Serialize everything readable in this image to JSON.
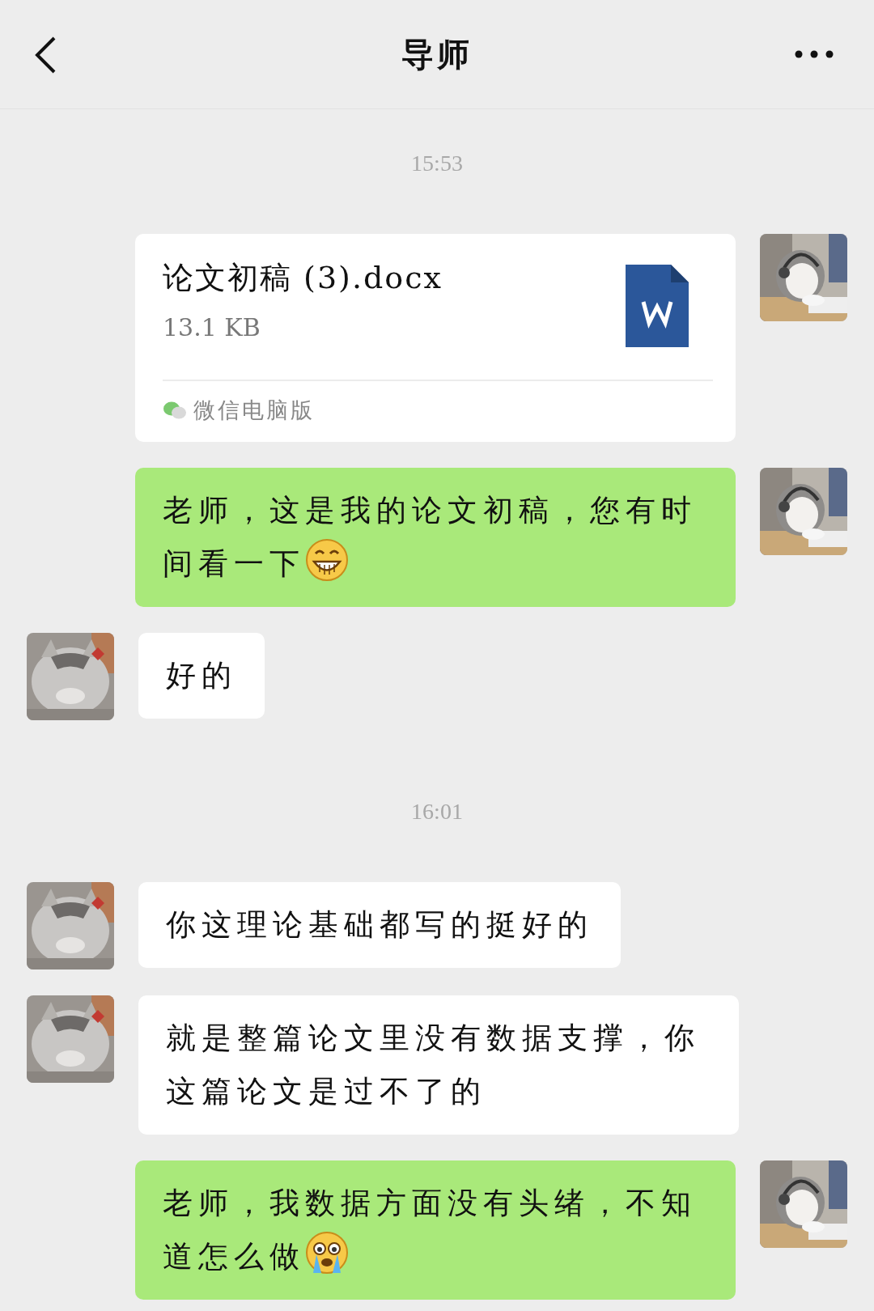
{
  "header": {
    "title": "导师"
  },
  "messages": [
    {
      "kind": "time",
      "text": "15:53"
    },
    {
      "kind": "file",
      "outgoing": true,
      "name": "论文初稿 (3).docx",
      "size": "13.1 KB",
      "source": "微信电脑版"
    },
    {
      "kind": "text",
      "outgoing": true,
      "text": "老师，这是我的论文初稿，您有时间看一下",
      "emoji": {
        "kind": "grin"
      }
    },
    {
      "kind": "text",
      "outgoing": false,
      "text": "好的"
    },
    {
      "kind": "time",
      "text": "16:01"
    },
    {
      "kind": "text",
      "outgoing": false,
      "text": "你这理论基础都写的挺好的"
    },
    {
      "kind": "text",
      "outgoing": false,
      "text": "就是整篇论文里没有数据支撑，你这篇论文是过不了的"
    },
    {
      "kind": "text",
      "outgoing": true,
      "text": "老师，我数据方面没有头绪，不知道怎么做",
      "emoji": {
        "kind": "cry"
      }
    }
  ]
}
